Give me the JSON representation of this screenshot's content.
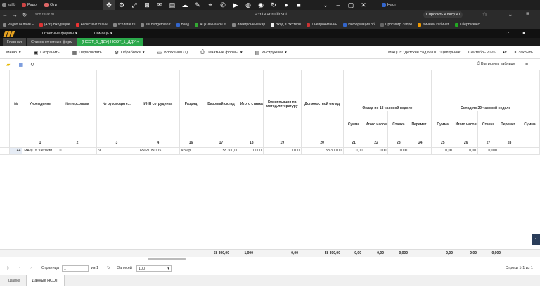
{
  "browser": {
    "tabs": [
      {
        "label": "ssl.b"
      },
      {
        "label": "Радо"
      },
      {
        "label": "Оти"
      },
      {
        "label": "Наст"
      }
    ],
    "url": "scb.tatar.ru/#osot",
    "address_left": "scb.tatar.ru",
    "ai_label": "Спросить Алису AI",
    "bookmarks": [
      "Радио онлайн –",
      "(436) Входящие",
      "Ассистент сканч",
      "scb.tatar.ru",
      "ssl.budgetplan.r",
      "Вход",
      "АЦК-Финансы.Ф",
      "Электронные кар",
      "Вход в Экстерн",
      "1 непрочитанны",
      "Информация об",
      "Просмотр Запро",
      "Личный кабинет",
      "СберБизнес"
    ]
  },
  "app": {
    "menu": [
      {
        "label": "Главная"
      },
      {
        "label": "Отчетные формы"
      },
      {
        "label": "Помощь"
      }
    ],
    "doc_tabs": [
      {
        "label": "Главная"
      },
      {
        "label": "Список отчетных форм"
      },
      {
        "label": "(НСОТ_1_ДДУ) НСОТ_1_ДДУ"
      }
    ]
  },
  "toolbar": {
    "menu_label": "Меню",
    "save_label": "Сохранить",
    "recalc_label": "Пересчитать",
    "process_label": "Обработки",
    "attach_label": "Вложения (1)",
    "print_label": "Печатные формы",
    "instr_label": "Инструкции",
    "org": "МАДОУ \"Детский сад №101 \"Щелкунчик\"",
    "period": "Сентябрь 2026",
    "close_label": "Закрыть",
    "export_label": "Выгрузить таблицу"
  },
  "grid": {
    "headers": [
      "№",
      "Учреждение",
      "№ персонала",
      "№ руководите...",
      "ИНН сотрудника",
      "Разряд",
      "Базовый оклад",
      "Итого ставка",
      "Компенсация на метод.литературу",
      "Должностной оклад"
    ],
    "group1": "Оклад по 18 часовой неделе",
    "group2": "Оклад по 20 часовой неделе",
    "sub1": [
      "Сумма",
      "Итого часов",
      "Ставка",
      "Перемет..."
    ],
    "sub2": [
      "Сумма",
      "Итого часов",
      "Ставка",
      "Перемет...",
      "Сумма"
    ],
    "nums": [
      "1",
      "2",
      "3",
      "4",
      "16",
      "17",
      "18",
      "19",
      "20",
      "21",
      "22",
      "23",
      "24",
      "25",
      "26",
      "27",
      "28"
    ],
    "row": [
      "44",
      "МАДОУ \"Детский ...",
      "0",
      "9",
      "165021050115",
      "Конгр.",
      "58 300,00",
      "1,000",
      "0,00",
      "58 300,00",
      "0,00",
      "0,00",
      "0,000",
      "",
      "0,00",
      "0,00",
      "0,000",
      ""
    ],
    "totals": [
      "58 300,00",
      "1,000",
      "0,00",
      "58 300,00",
      "0,00",
      "0,00",
      "0,000",
      "0,00",
      "0,00",
      "0,000"
    ]
  },
  "pager": {
    "page_label": "Страница",
    "page_value": "1",
    "of_label": "из 1",
    "records_label": "Записей",
    "records_value": "100",
    "summary": "Строки 1-1 из 1"
  },
  "bottom_tabs": [
    {
      "label": "Шапка"
    },
    {
      "label": "Данные НСОТ"
    }
  ]
}
